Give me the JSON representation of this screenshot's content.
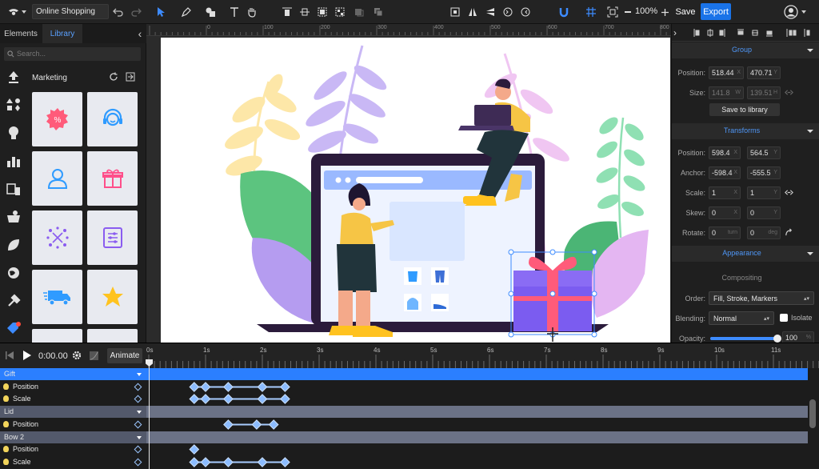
{
  "toolbar": {
    "document_title": "Online Shopping",
    "zoom": "100%",
    "save_label": "Save",
    "export_label": "Export"
  },
  "left_panel": {
    "tabs": [
      "Elements",
      "Library"
    ],
    "active_tab": "Library",
    "search_placeholder": "Search...",
    "category_title": "Marketing",
    "categories": [
      "upload-icon",
      "shapes-icon",
      "lightbulb-icon",
      "business-chart-icon",
      "devices-icon",
      "food-icon",
      "leaf-icon",
      "globe-icon",
      "tools-icon",
      "marketing-tag-icon"
    ],
    "items": [
      "discount-badge-icon",
      "support-agent-icon",
      "user-icon",
      "gift-icon",
      "network-icon",
      "settings-list-icon",
      "delivery-truck-icon",
      "star-icon"
    ]
  },
  "ruler": {
    "marks": [
      "0",
      "100",
      "200",
      "300",
      "400",
      "500",
      "600",
      "700",
      "800"
    ]
  },
  "inspector": {
    "group_section": "Group",
    "position_label": "Position:",
    "group_position_x": "518.44",
    "group_position_y": "470.71",
    "size_label": "Size:",
    "size_w": "141.8",
    "size_h": "139.51",
    "save_to_library": "Save to library",
    "transforms_section": "Transforms",
    "t_position_x": "598.4",
    "t_position_y": "564.5",
    "anchor_label": "Anchor:",
    "anchor_x": "-598.4",
    "anchor_y": "-555.5",
    "scale_label": "Scale:",
    "scale_x": "1",
    "scale_y": "1",
    "skew_label": "Skew:",
    "skew_x": "0",
    "skew_y": "0",
    "rotate_label": "Rotate:",
    "rotate_turn": "0",
    "rotate_deg": "0",
    "appearance_section": "Appearance",
    "compositing_label": "Compositing",
    "order_label": "Order:",
    "order_value": "Fill, Stroke, Markers",
    "blending_label": "Blending:",
    "blending_value": "Normal",
    "isolate_label": "Isolate",
    "opacity_label": "Opacity:",
    "opacity_value": "100",
    "opacity_level": 1.0,
    "units": {
      "w": "W",
      "h": "H",
      "x": "X",
      "y": "Y",
      "turn": "turn",
      "deg": "deg"
    }
  },
  "timeline": {
    "time": "0:00.00",
    "animate_label": "Animate",
    "seconds": [
      "0s",
      "1s",
      "2s",
      "3s",
      "4s",
      "5s",
      "6s",
      "7s",
      "8s",
      "9s",
      "10s",
      "11s"
    ],
    "tracks": [
      {
        "name": "Gift",
        "type": "group"
      },
      {
        "name": "Position",
        "type": "property",
        "keys": [
          0.8,
          1.0,
          1.4,
          2.0,
          2.4
        ]
      },
      {
        "name": "Scale",
        "type": "property",
        "keys": [
          0.8,
          1.0,
          1.4,
          2.0,
          2.4
        ]
      },
      {
        "name": "Lid",
        "type": "group"
      },
      {
        "name": "Position",
        "type": "property",
        "keys": [
          1.4,
          1.9,
          2.2
        ]
      },
      {
        "name": "Bow 2",
        "type": "group"
      },
      {
        "name": "Position",
        "type": "property",
        "keys": [
          0.8
        ]
      },
      {
        "name": "Scale",
        "type": "property",
        "keys": [
          0.8,
          1.0,
          1.4,
          2.0,
          2.4
        ]
      }
    ]
  }
}
